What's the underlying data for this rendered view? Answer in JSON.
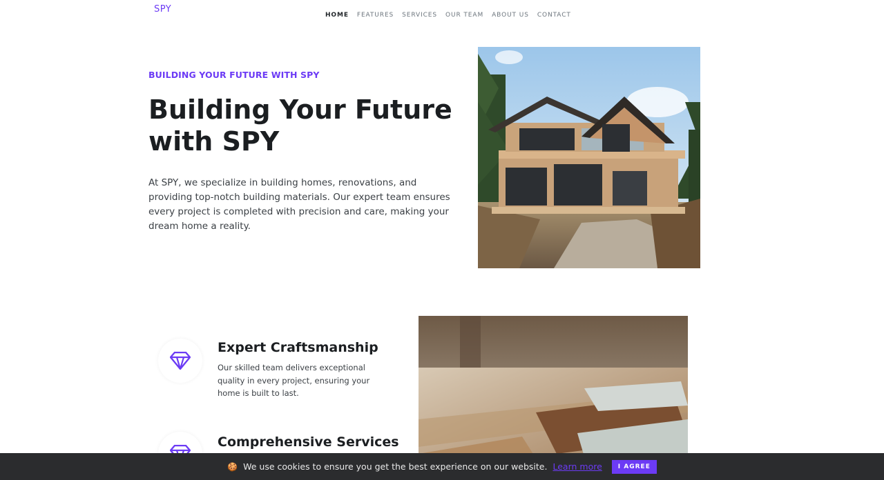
{
  "brand": "SPY",
  "nav": {
    "items": [
      "HOME",
      "FEATURES",
      "SERVICES",
      "OUR TEAM",
      "ABOUT US",
      "CONTACT"
    ],
    "active": "HOME"
  },
  "hero": {
    "kicker": "BUILDING YOUR FUTURE WITH SPY",
    "title": "Building Your Future with SPY",
    "text": "At SPY, we specialize in building homes, renovations, and providing top-notch building materials. Our expert team ensures every project is completed with precision and care, making your dream home a reality."
  },
  "features": [
    {
      "icon": "diamond-icon",
      "title": "Expert Craftsmanship",
      "text": "Our skilled team delivers exceptional quality in every project, ensuring your home is built to last."
    },
    {
      "icon": "diamond-icon",
      "title": "Comprehensive Services"
    }
  ],
  "cookie": {
    "emoji": "🍪",
    "text": "We use cookies to ensure you get the best experience on our website.",
    "link": "Learn more",
    "button": "I AGREE"
  },
  "colors": {
    "accent": "#6c3bf5",
    "cookie_bg": "#2b2c2e"
  }
}
